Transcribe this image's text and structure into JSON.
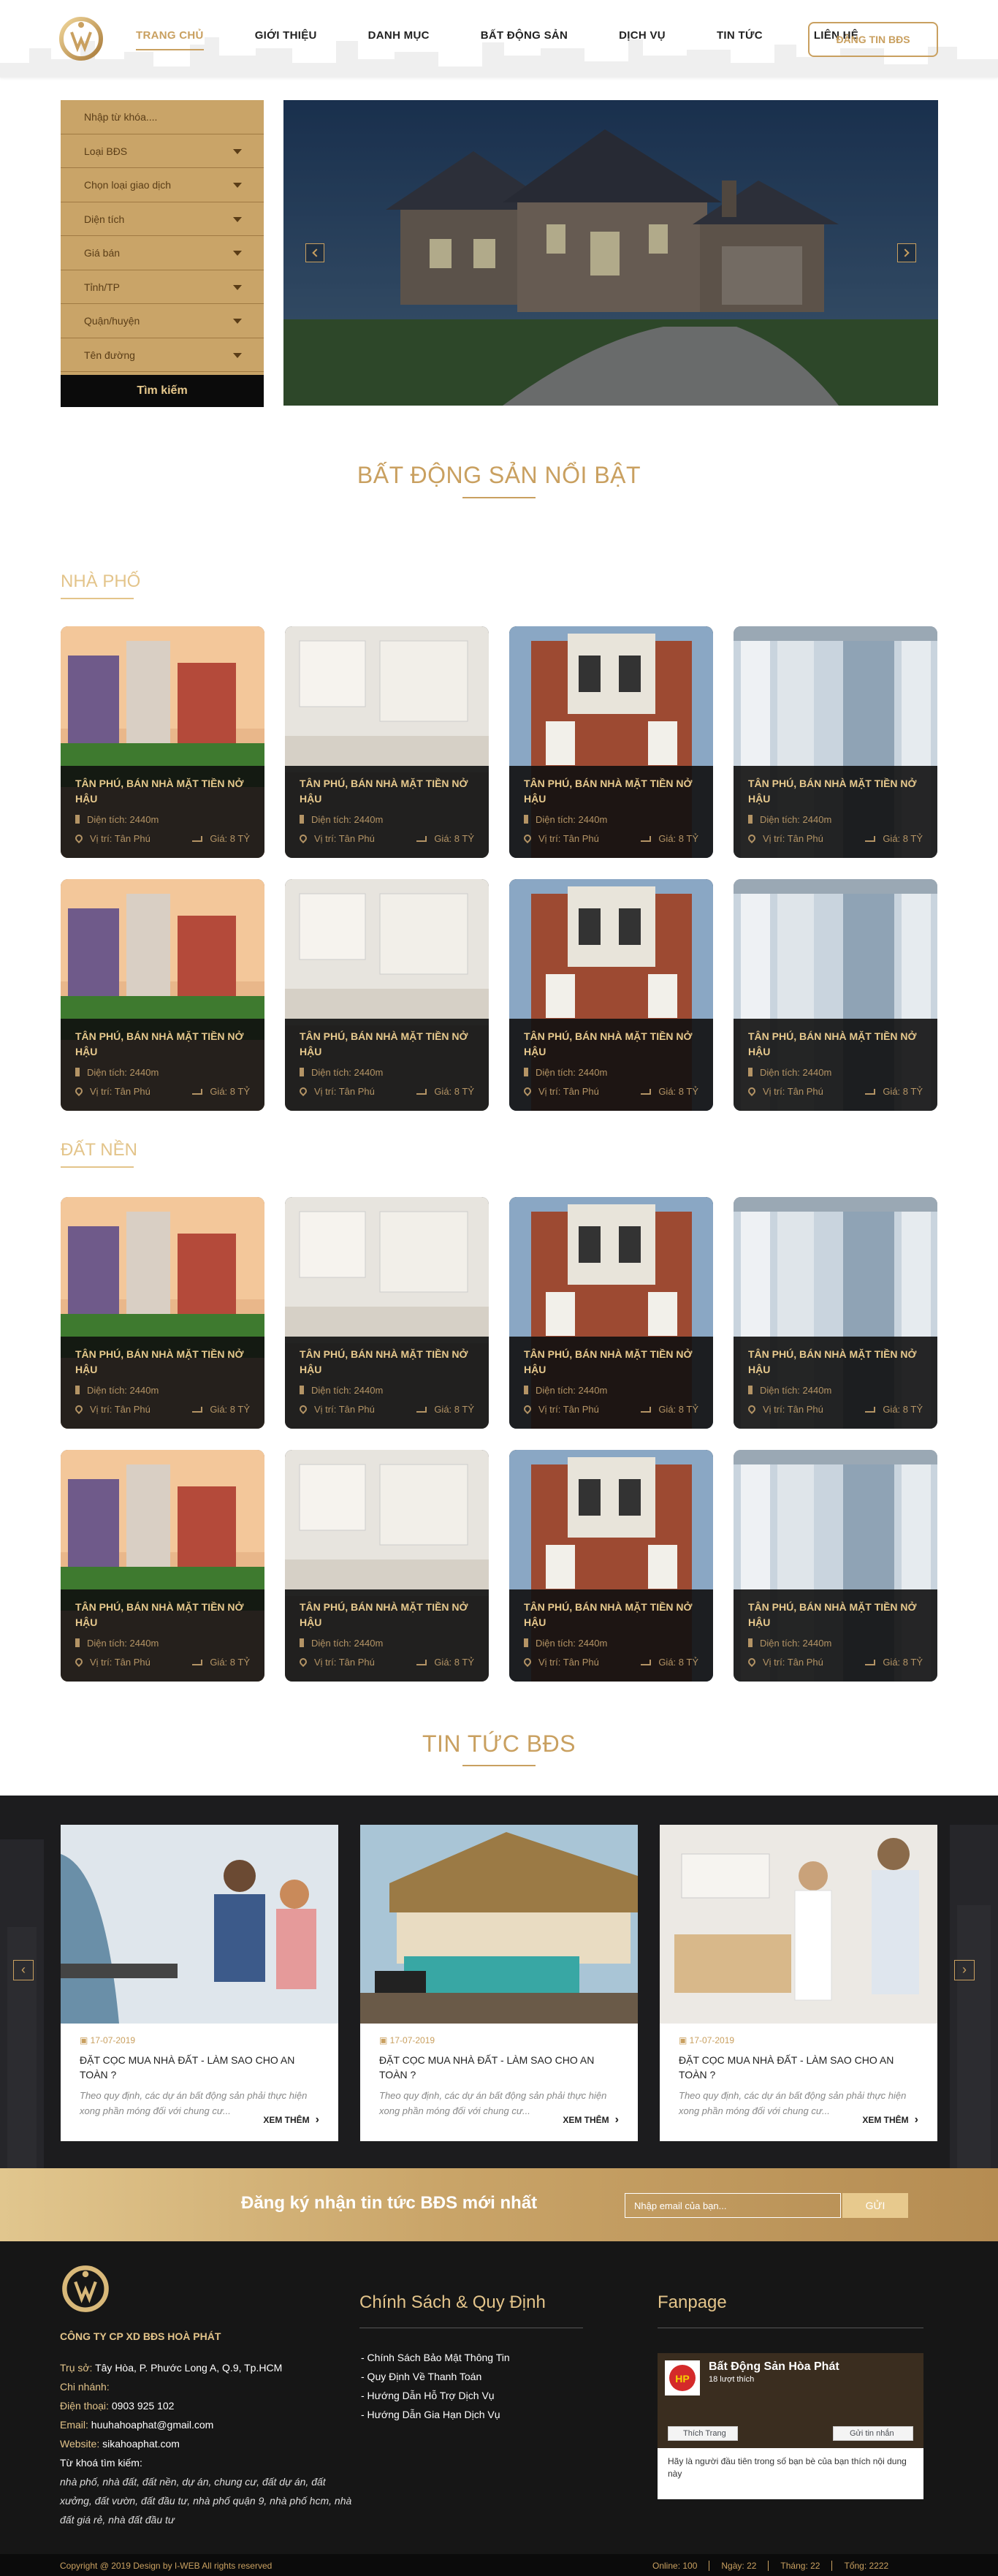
{
  "header": {
    "nav": [
      "TRANG CHỦ",
      "GIỚI THIỆU",
      "DANH MỤC",
      "BẤT ĐỘNG SẢN",
      "DỊCH VỤ",
      "TIN TỨC",
      "LIÊN HỆ"
    ],
    "active_nav": "TRANG CHỦ",
    "post_button": "ĐĂNG TIN BĐS"
  },
  "search": {
    "keyword_placeholder": "Nhập từ khóa....",
    "fields": [
      "Loại BĐS",
      "Chọn loại giao dịch",
      "Diện tích",
      "Giá bán",
      "Tỉnh/TP",
      "Quận/huyện",
      "Tên đường"
    ],
    "submit": "Tìm kiếm"
  },
  "featured": {
    "title": "BẤT ĐỘNG SẢN NỔI BẬT",
    "categories": [
      "NHÀ PHỐ",
      "ĐẤT NỀN"
    ]
  },
  "card": {
    "title": "TÂN PHÚ, BÁN NHÀ MẶT TIỀN NỞ HẬU",
    "area": "Diện tích: 2440m",
    "location": "Vị trí: Tân Phú",
    "price": "Giá: 8 TỶ"
  },
  "news": {
    "title": "TIN TỨC BĐS",
    "items": [
      {
        "date": "17-07-2019",
        "title": "ĐẶT CỌC MUA NHÀ ĐẤT - LÀM SAO CHO AN TOÀN ?",
        "excerpt": "Theo quy định, các dự án bất động sản phải thực hiện xong phần móng đối với chung cư...",
        "more": "XEM THÊM"
      },
      {
        "date": "17-07-2019",
        "title": "ĐẶT CỌC MUA NHÀ ĐẤT - LÀM SAO CHO AN TOÀN ?",
        "excerpt": "Theo quy định, các dự án bất động sản phải thực hiện xong phần móng đối với chung cư...",
        "more": "XEM THÊM"
      },
      {
        "date": "17-07-2019",
        "title": "ĐẶT CỌC MUA NHÀ ĐẤT - LÀM SAO CHO AN TOÀN ?",
        "excerpt": "Theo quy định, các dự án bất động sản phải thực hiện xong phần móng đối với chung cư...",
        "more": "XEM THÊM"
      }
    ]
  },
  "newsletter": {
    "title": "Đăng ký nhận tin tức BĐS mới nhất",
    "placeholder": "Nhập email của bạn...",
    "button": "GỬI"
  },
  "footer": {
    "company": "CÔNG TY CP XD BĐS HOÀ PHÁT",
    "head_office_label": "Trụ sở:",
    "head_office": "Tây Hòa, P. Phước Long A, Q.9, Tp.HCM",
    "branch_label": "Chi nhánh:",
    "phone_label": "Điện thoại:",
    "phone": "0903 925 102",
    "email_label": "Email:",
    "email": "huuhahoaphat@gmail.com",
    "website_label": "Website:",
    "website": "sikahoaphat.com",
    "keywords_label": "Từ khoá tìm kiếm:",
    "keywords": "nhà phố, nhà đất, đất nền, dự án, chung cư, đất dự án, đất xưởng, đất vườn, đất đầu tư, nhà phố quận 9, nhà phố hcm, nhà đất giá rẻ, nhà đất đầu tư",
    "policy_title": "Chính Sách & Quy Định",
    "policies": [
      "- Chính Sách Bảo Mật Thông Tin",
      "- Quy Định Về Thanh Toán",
      "- Hướng Dẫn Hỗ Trợ Dịch Vụ",
      "- Hướng Dẫn Gia Hạn Dịch Vụ"
    ],
    "fanpage_title": "Fanpage",
    "fanpage": {
      "name": "Bất Động Sản Hòa Phát",
      "likes": "18 lượt thích",
      "like_button": "Thích Trang",
      "message_button": "Gửi tin nhắn",
      "note": "Hãy là người đầu tiên trong số bạn bè của bạn thích nội dung này"
    },
    "copyright": "Copyright @ 2019 Design by I-WEB All rights reserved",
    "stats": [
      "Online: 100",
      "Ngày: 22",
      "Tháng: 22",
      "Tổng: 2222"
    ]
  },
  "colors": {
    "accent": "#c9a060",
    "dark": "#161616"
  }
}
